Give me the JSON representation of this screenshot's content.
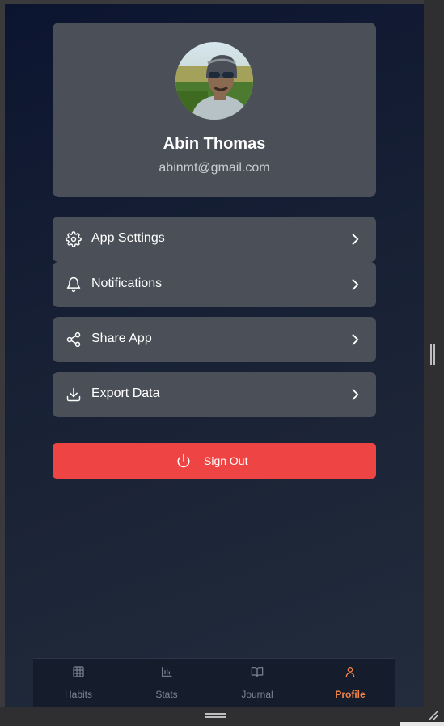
{
  "profile": {
    "name": "Abin Thomas",
    "email": "abinmt@gmail.com",
    "avatar_icon": "user-photo"
  },
  "menu": [
    {
      "label": "App Settings",
      "icon": "gear-icon"
    },
    {
      "label": "Notifications",
      "icon": "bell-icon"
    },
    {
      "label": "Share App",
      "icon": "share-icon"
    },
    {
      "label": "Export Data",
      "icon": "download-icon"
    }
  ],
  "signout": {
    "label": "Sign Out",
    "icon": "power-icon",
    "color": "#ef4444"
  },
  "tabs": [
    {
      "label": "Habits",
      "icon": "grid-icon",
      "active": false
    },
    {
      "label": "Stats",
      "icon": "bar-chart-icon",
      "active": false
    },
    {
      "label": "Journal",
      "icon": "book-icon",
      "active": false
    },
    {
      "label": "Profile",
      "icon": "user-icon",
      "active": true
    }
  ],
  "colors": {
    "accent": "#f0844a",
    "card": "#4b4f57",
    "danger": "#ef4444"
  }
}
